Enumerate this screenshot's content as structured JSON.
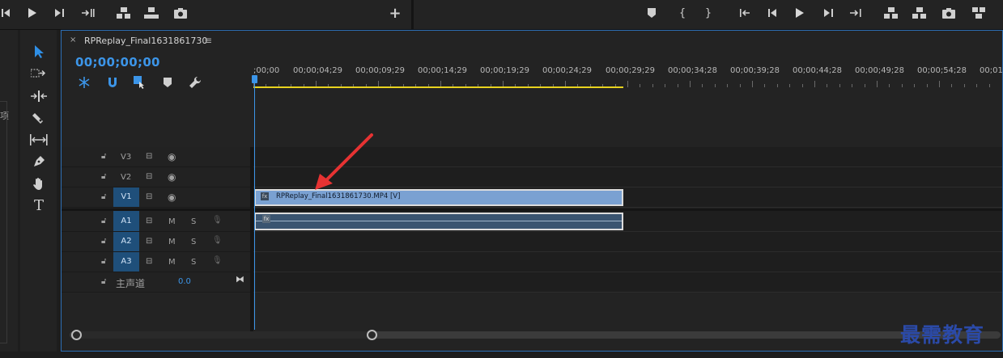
{
  "sequence": {
    "tab_close": "×",
    "tab_title": "RPReplay_Final1631861730",
    "tab_menu": "≡",
    "timecode": "00;00;00;00"
  },
  "ruler": {
    "labels": [
      ";00;00",
      "00;00;04;29",
      "00;00;09;29",
      "00;00;14;29",
      "00;00;19;29",
      "00;00;24;29",
      "00;00;29;29",
      "00;00;34;28",
      "00;00;39;28",
      "00;00;44;28",
      "00;00;49;28",
      "00;00;54;28",
      "00;01"
    ]
  },
  "tracks": {
    "video": [
      {
        "name": "V3",
        "target": ""
      },
      {
        "name": "V2",
        "target": ""
      },
      {
        "name": "V1",
        "target": "V1"
      }
    ],
    "audio": [
      {
        "target": "A1",
        "m": "M",
        "s": "S"
      },
      {
        "target": "A2",
        "m": "M",
        "s": "S"
      },
      {
        "target": "A3",
        "m": "M",
        "s": "S"
      }
    ],
    "master": {
      "label": "主声道",
      "value": "0.0"
    }
  },
  "clips": {
    "video_label": "RPReplay_Final1631861730.MP4 [V]",
    "video_fx": "fx",
    "audio_fx": "fx"
  },
  "left_panel": {
    "char": "项"
  },
  "watermark": "最需教育",
  "colors": {
    "accent": "#3c95e8",
    "workarea": "#e8d31e",
    "video_clip": "#7aa1d2",
    "audio_clip": "#3a5470",
    "annotation": "#e63232"
  }
}
